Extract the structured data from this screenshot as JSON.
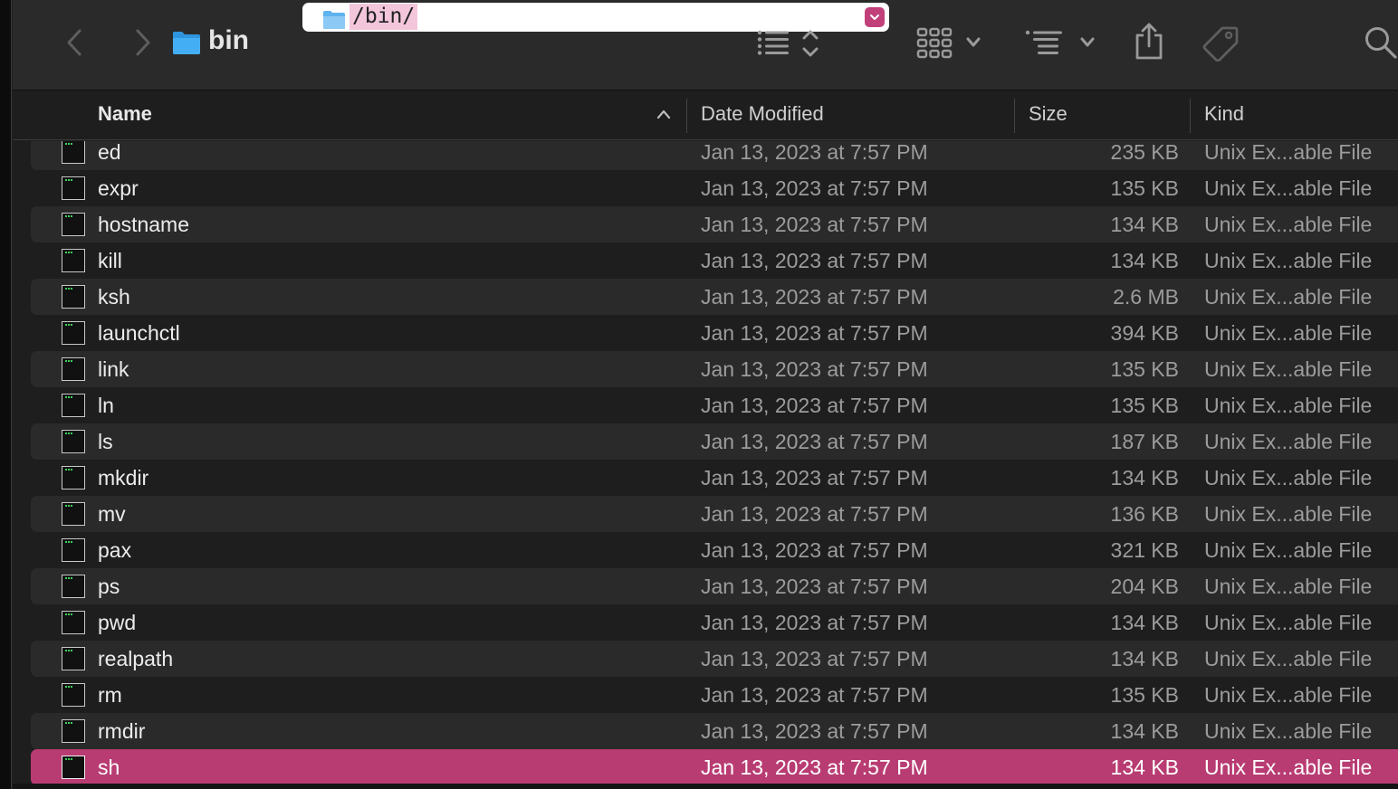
{
  "window": {
    "title": "bin",
    "path_field": {
      "value": "/bin/"
    }
  },
  "toolbar": {
    "icons": [
      "chevron-left-icon",
      "chevron-right-icon",
      "folder-icon",
      "list-view-icon",
      "sort-updown-icon",
      "icon-grid-icon",
      "chevron-down-icon",
      "group-list-icon",
      "share-icon",
      "tag-icon",
      "search-icon"
    ]
  },
  "columns": {
    "name": "Name",
    "date": "Date Modified",
    "size": "Size",
    "kind": "Kind"
  },
  "files": [
    {
      "name": "ed",
      "date": "Jan 13, 2023 at 7:57 PM",
      "size": "235 KB",
      "kind": "Unix Ex...able File"
    },
    {
      "name": "expr",
      "date": "Jan 13, 2023 at 7:57 PM",
      "size": "135 KB",
      "kind": "Unix Ex...able File"
    },
    {
      "name": "hostname",
      "date": "Jan 13, 2023 at 7:57 PM",
      "size": "134 KB",
      "kind": "Unix Ex...able File"
    },
    {
      "name": "kill",
      "date": "Jan 13, 2023 at 7:57 PM",
      "size": "134 KB",
      "kind": "Unix Ex...able File"
    },
    {
      "name": "ksh",
      "date": "Jan 13, 2023 at 7:57 PM",
      "size": "2.6 MB",
      "kind": "Unix Ex...able File"
    },
    {
      "name": "launchctl",
      "date": "Jan 13, 2023 at 7:57 PM",
      "size": "394 KB",
      "kind": "Unix Ex...able File"
    },
    {
      "name": "link",
      "date": "Jan 13, 2023 at 7:57 PM",
      "size": "135 KB",
      "kind": "Unix Ex...able File"
    },
    {
      "name": "ln",
      "date": "Jan 13, 2023 at 7:57 PM",
      "size": "135 KB",
      "kind": "Unix Ex...able File"
    },
    {
      "name": "ls",
      "date": "Jan 13, 2023 at 7:57 PM",
      "size": "187 KB",
      "kind": "Unix Ex...able File"
    },
    {
      "name": "mkdir",
      "date": "Jan 13, 2023 at 7:57 PM",
      "size": "134 KB",
      "kind": "Unix Ex...able File"
    },
    {
      "name": "mv",
      "date": "Jan 13, 2023 at 7:57 PM",
      "size": "136 KB",
      "kind": "Unix Ex...able File"
    },
    {
      "name": "pax",
      "date": "Jan 13, 2023 at 7:57 PM",
      "size": "321 KB",
      "kind": "Unix Ex...able File"
    },
    {
      "name": "ps",
      "date": "Jan 13, 2023 at 7:57 PM",
      "size": "204 KB",
      "kind": "Unix Ex...able File"
    },
    {
      "name": "pwd",
      "date": "Jan 13, 2023 at 7:57 PM",
      "size": "134 KB",
      "kind": "Unix Ex...able File"
    },
    {
      "name": "realpath",
      "date": "Jan 13, 2023 at 7:57 PM",
      "size": "134 KB",
      "kind": "Unix Ex...able File"
    },
    {
      "name": "rm",
      "date": "Jan 13, 2023 at 7:57 PM",
      "size": "135 KB",
      "kind": "Unix Ex...able File"
    },
    {
      "name": "rmdir",
      "date": "Jan 13, 2023 at 7:57 PM",
      "size": "134 KB",
      "kind": "Unix Ex...able File"
    },
    {
      "name": "sh",
      "date": "Jan 13, 2023 at 7:57 PM",
      "size": "134 KB",
      "kind": "Unix Ex...able File",
      "selected": true
    }
  ],
  "colors": {
    "selection": "#b83c72",
    "path_highlight": "#f3c6dc",
    "folder_blue": "#3aa8f0"
  }
}
